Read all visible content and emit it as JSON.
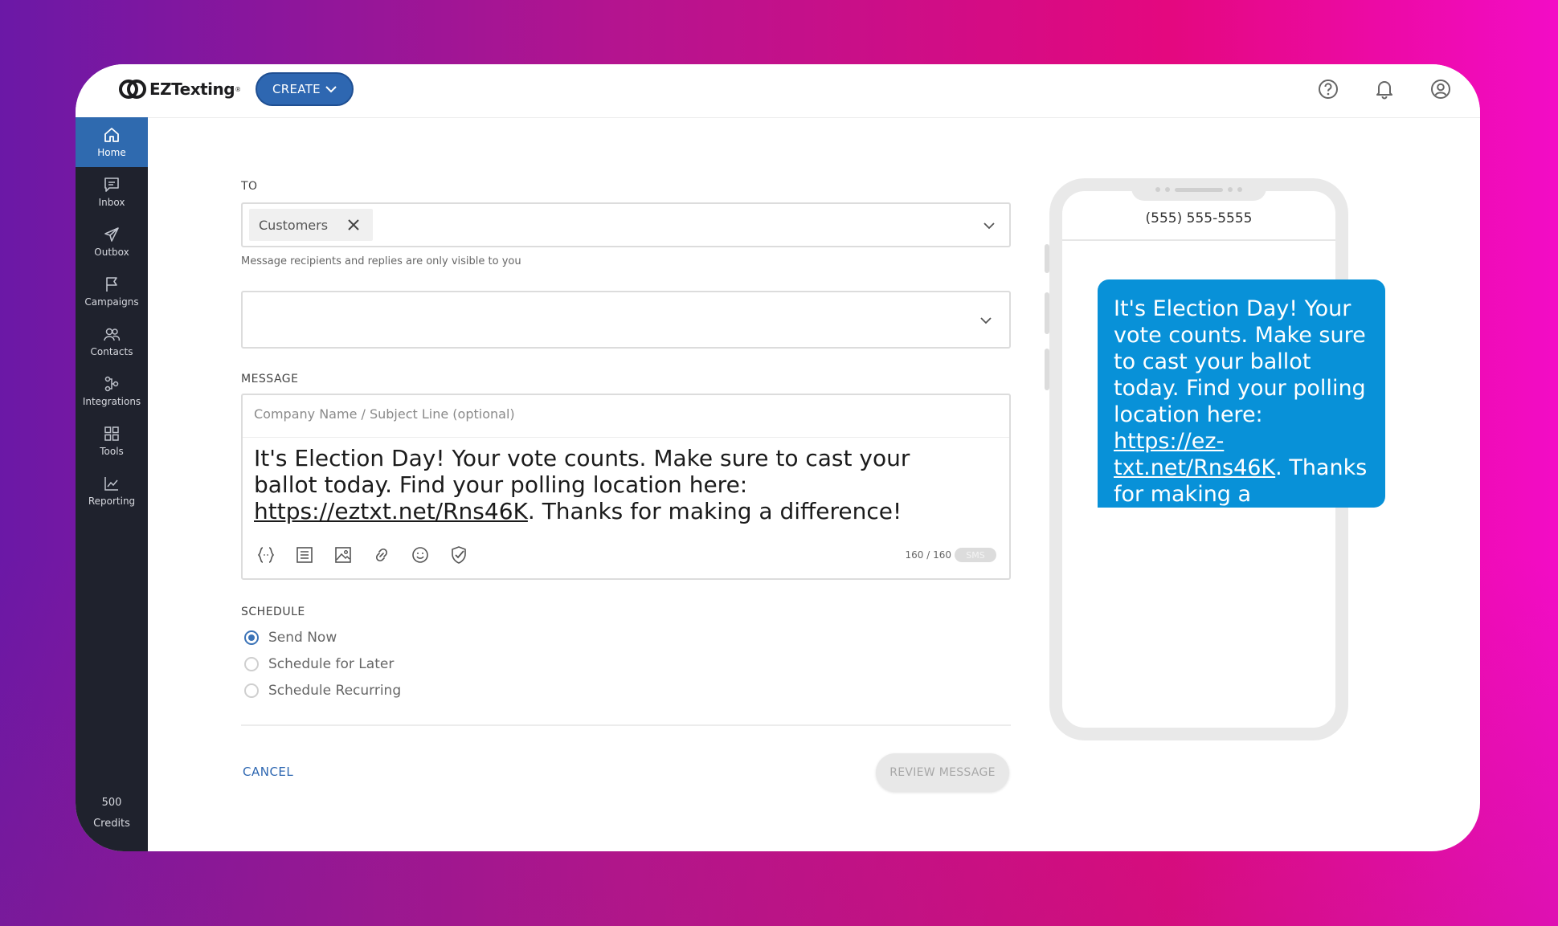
{
  "app": {
    "logo_text": "EZTexting",
    "logo_reg": "®",
    "create_label": "CREATE"
  },
  "sidebar": {
    "items": [
      {
        "label": "Home",
        "icon": "home-icon",
        "active": true
      },
      {
        "label": "Inbox",
        "icon": "inbox-icon"
      },
      {
        "label": "Outbox",
        "icon": "send-icon"
      },
      {
        "label": "Campaigns",
        "icon": "flag-icon"
      },
      {
        "label": "Contacts",
        "icon": "contacts-icon"
      },
      {
        "label": "Integrations",
        "icon": "integrations-icon"
      },
      {
        "label": "Tools",
        "icon": "grid-icon"
      },
      {
        "label": "Reporting",
        "icon": "chart-icon"
      }
    ],
    "credits_value": "500",
    "credits_label": "Credits"
  },
  "form": {
    "to_label": "TO",
    "recipient_chip": "Customers",
    "to_help": "Message recipients and replies are only visible to you",
    "second_select_value": "",
    "message_label": "MESSAGE",
    "subject_placeholder": "Company Name / Subject Line (optional)",
    "message_before_link": "It's Election Day! Your vote counts. Make sure to cast your ballot today. Find your polling location here: ",
    "message_link": "https://eztxt.net/Rns46K",
    "message_after_link": ". Thanks for making a difference!",
    "char_count": "160 / 160",
    "sms_badge": "SMS",
    "schedule_label": "SCHEDULE",
    "schedule_options": [
      "Send Now",
      "Schedule for Later",
      "Schedule Recurring"
    ],
    "selected_schedule": "Send Now",
    "cancel_label": "CANCEL",
    "review_label": "REVIEW MESSAGE"
  },
  "preview": {
    "phone_number": "(555) 555-5555",
    "bubble_before_link": "It's Election Day! Your vote counts. Make sure to cast your ballot today. Find your polling location here: ",
    "bubble_link": "https://ez-txt.net/Rns46K",
    "bubble_after_link": ". Thanks for making a difference!"
  },
  "colors": {
    "accent": "#2e67b1",
    "sidebar": "#1f222d",
    "bubble": "#0891d8"
  }
}
